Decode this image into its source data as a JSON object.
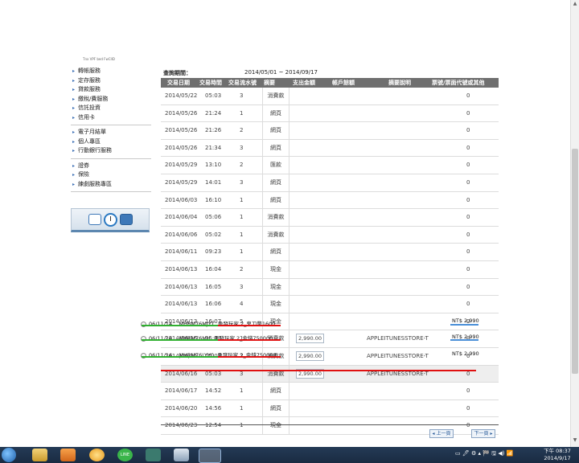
{
  "page": {
    "tiny_logo": "Tnx VPF bed FwCIID"
  },
  "sidebar": {
    "groups": [
      {
        "items": [
          "轉帳服務",
          "定存服務",
          "貸款服務",
          "繳稅/費服務",
          "信託投資",
          "信用卡"
        ]
      },
      {
        "items": [
          "電子月結單",
          "個人專區",
          "行動銀行服務"
        ]
      },
      {
        "items": [
          "證券",
          "保險",
          "練劇服務專區"
        ]
      }
    ],
    "tools": [
      "calendar-icon",
      "clock-icon",
      "calculator-icon"
    ]
  },
  "query": {
    "label": "查詢期間：",
    "range": "2014/05/01 ~ 2014/09/17"
  },
  "table": {
    "headers": [
      "交易日期",
      "交易時間",
      "交易流水號",
      "摘要",
      "支出金額",
      "帳戶餘額",
      "摘要說明",
      "票號/票面代號或其他"
    ],
    "rows": [
      {
        "date": "2014/05/22",
        "time": "05:03",
        "seq": "3",
        "memo": "消費款",
        "out": "",
        "desc": "",
        "other": "0"
      },
      {
        "date": "2014/05/26",
        "time": "21:24",
        "seq": "1",
        "memo": "網頁",
        "out": "",
        "desc": "",
        "other": "0"
      },
      {
        "date": "2014/05/26",
        "time": "21:26",
        "seq": "2",
        "memo": "網頁",
        "out": "",
        "desc": "",
        "other": "0"
      },
      {
        "date": "2014/05/26",
        "time": "21:34",
        "seq": "3",
        "memo": "網頁",
        "out": "",
        "desc": "",
        "other": "0"
      },
      {
        "date": "2014/05/29",
        "time": "13:10",
        "seq": "2",
        "memo": "匯款",
        "out": "",
        "desc": "",
        "other": "0"
      },
      {
        "date": "2014/05/29",
        "time": "14:01",
        "seq": "3",
        "memo": "網頁",
        "out": "",
        "desc": "",
        "other": "0"
      },
      {
        "date": "2014/06/03",
        "time": "16:10",
        "seq": "1",
        "memo": "網頁",
        "out": "",
        "desc": "",
        "other": "0"
      },
      {
        "date": "2014/06/04",
        "time": "05:06",
        "seq": "1",
        "memo": "消費款",
        "out": "",
        "desc": "",
        "other": "0"
      },
      {
        "date": "2014/06/06",
        "time": "05:02",
        "seq": "1",
        "memo": "消費款",
        "out": "",
        "desc": "",
        "other": "0"
      },
      {
        "date": "2014/06/11",
        "time": "09:23",
        "seq": "1",
        "memo": "網頁",
        "out": "",
        "desc": "",
        "other": "0"
      },
      {
        "date": "2014/06/13",
        "time": "16:04",
        "seq": "2",
        "memo": "現金",
        "out": "",
        "desc": "",
        "other": "0"
      },
      {
        "date": "2014/06/13",
        "time": "16:05",
        "seq": "3",
        "memo": "現金",
        "out": "",
        "desc": "",
        "other": "0"
      },
      {
        "date": "2014/06/13",
        "time": "16:06",
        "seq": "4",
        "memo": "現金",
        "out": "",
        "desc": "",
        "other": "0"
      },
      {
        "date": "2014/06/13",
        "time": "16:07",
        "seq": "5",
        "memo": "現金",
        "out": "",
        "desc": "",
        "other": "0"
      },
      {
        "date": "2014/06/16",
        "time": "05:03",
        "seq": "1",
        "memo": "消費款",
        "out": "2,990.00",
        "desc": "APPLEITUNESSTORE-T",
        "other": "0"
      },
      {
        "date": "2014/06/16",
        "time": "05:03",
        "seq": "2",
        "memo": "消費款",
        "out": "2,990.00",
        "desc": "APPLEITUNESSTORE-T",
        "other": "0"
      },
      {
        "date": "2014/06/16",
        "time": "05:03",
        "seq": "3",
        "memo": "消費款",
        "out": "2,990.00",
        "desc": "APPLEITUNESSTORE-T",
        "other": "0"
      },
      {
        "date": "2014/06/17",
        "time": "14:52",
        "seq": "1",
        "memo": "網頁",
        "out": "",
        "desc": "",
        "other": "0"
      },
      {
        "date": "2014/06/20",
        "time": "14:56",
        "seq": "1",
        "memo": "網頁",
        "out": "",
        "desc": "",
        "other": "0"
      },
      {
        "date": "2014/06/23",
        "time": "12:54",
        "seq": "1",
        "memo": "現金",
        "out": "",
        "desc": "",
        "other": "0"
      }
    ]
  },
  "overlays": [
    {
      "date": "06/11/14",
      "code": "MHBM76MJYT",
      "text": "勇發玩家 2_鬼刀幣1600",
      "amount": "NT$ 2,990"
    },
    {
      "date": "06/11/14",
      "code": "MHBM76MH",
      "text": "勇發玩家 2_金錢750000",
      "amount": "NT$ 2,990"
    },
    {
      "date": "06/11/14",
      "code": "MHBM76LYY0",
      "text": "勇發玩家 2_金錢750000",
      "amount": "NT$ 2,990"
    }
  ],
  "pager": {
    "prev": "◂ 上一頁",
    "next": "下一頁 ▸"
  },
  "taskbar": {
    "apps": [
      "start-orb",
      "file-explorer-icon",
      "media-player-icon",
      "game-app-icon",
      "line-app-icon",
      "pdf-reader-icon",
      "tool-app-icon",
      "firefox-icon"
    ],
    "tray_text": "▭ 🖊 ⚙ ▴ 🏁 🖫 ◀) 📶",
    "time": "下午 08:37",
    "date": "2014/9/17"
  }
}
